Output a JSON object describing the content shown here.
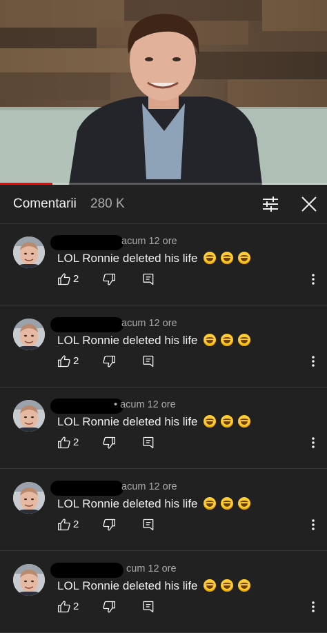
{
  "video": {
    "progress_fraction": 0.16
  },
  "header": {
    "title": "Comentarii",
    "count": "280 K",
    "filter_icon": "sliders-icon",
    "close_icon": "close-icon"
  },
  "comments": [
    {
      "timestamp": "acum 12 ore",
      "text": "LOL Ronnie deleted his life",
      "likes": "2"
    },
    {
      "timestamp": "acum 12 ore",
      "text": "LOL Ronnie deleted his life",
      "likes": "2"
    },
    {
      "timestamp": "• acum 12 ore",
      "text": "LOL Ronnie deleted his life",
      "likes": "2"
    },
    {
      "timestamp": "acum 12 ore",
      "text": "LOL Ronnie deleted his life",
      "likes": "2"
    },
    {
      "timestamp": "cum 12 ore",
      "text": "LOL Ronnie deleted his life",
      "likes": "2"
    }
  ],
  "icons": {
    "like": "thumbs-up-icon",
    "dislike": "thumbs-down-icon",
    "reply": "reply-icon",
    "more": "more-vertical-icon"
  },
  "colors": {
    "background": "#212121",
    "text_primary": "#f1f1f1",
    "text_secondary": "#aaaaaa",
    "progress": "#ff0000"
  }
}
